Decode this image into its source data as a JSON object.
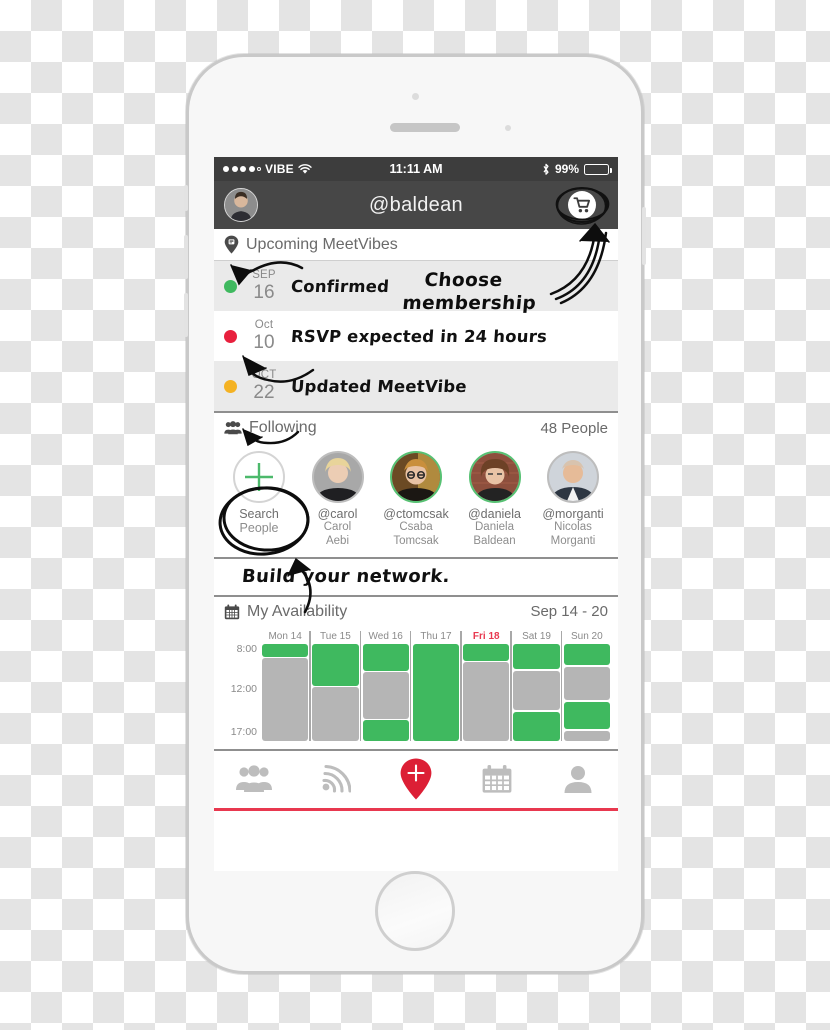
{
  "device": {
    "name": "iphone-white",
    "frame_color": "#f7f7f7",
    "accent_red": "#e8384f"
  },
  "status_bar": {
    "carrier": "VIBE",
    "signal_filled": 4,
    "signal_total": 5,
    "wifi_icon": "wifi-icon",
    "time": "11:11 AM",
    "bluetooth_icon": "bluetooth-icon",
    "battery_percent": "99%",
    "battery_level": 99
  },
  "nav_bar": {
    "avatar_icon": "user-avatar",
    "title": "@baldean",
    "cart_icon": "shopping-cart-icon"
  },
  "upcoming": {
    "header_icon": "map-pin-icon",
    "header_title": "Upcoming MeetVibes",
    "rows": [
      {
        "dot_color": "#3fb95f",
        "status": "confirmed",
        "month": "SEP",
        "day": "16",
        "note": "Confirmed"
      },
      {
        "dot_color": "#e8203d",
        "status": "rsvp-pending",
        "month": "Oct",
        "day": "10",
        "note": "RSVP expected in 24 hours"
      },
      {
        "dot_color": "#f4b223",
        "status": "updated",
        "month": "OCT",
        "day": "22",
        "note": "Updated MeetVibe"
      }
    ]
  },
  "following": {
    "header_icon": "people-group-icon",
    "header_title": "Following",
    "count_label": "48 People",
    "items": [
      {
        "type": "add",
        "icon": "plus-icon",
        "handle": "Search",
        "name": "People",
        "online": false,
        "ring": "#d4d4d4"
      },
      {
        "type": "person",
        "handle": "@carol",
        "name_line1": "Carol",
        "name_line2": "Aebi",
        "online": false,
        "ring": "#bdbdbd"
      },
      {
        "type": "person",
        "handle": "@ctomcsak",
        "name_line1": "Csaba",
        "name_line2": "Tomcsak",
        "online": true,
        "ring": "#57c173"
      },
      {
        "type": "person",
        "handle": "@daniela",
        "name_line1": "Daniela",
        "name_line2": "Baldean",
        "online": true,
        "ring": "#57c173"
      },
      {
        "type": "person",
        "handle": "@morganti",
        "name_line1": "Nicolas",
        "name_line2": "Morganti",
        "online": false,
        "ring": "#bdbdbd"
      }
    ]
  },
  "build_band": {
    "text": "Build your network."
  },
  "availability": {
    "header_icon": "calendar-icon",
    "header_title": "My Availability",
    "date_range": "Sep 14 - 20"
  },
  "chart_data": {
    "type": "bar",
    "title": "My Availability",
    "subtitle": "Sep 14 - 20",
    "xlabel": "",
    "ylabel": "",
    "grid": false,
    "legend_position": "none",
    "y_ticks": [
      "8:00",
      "12:00",
      "17:00"
    ],
    "y_tick_positions_pct": [
      4,
      46,
      96
    ],
    "ylim_labels": [
      "8:00",
      "17:00"
    ],
    "categories": [
      "Mon 14",
      "Tue 15",
      "Wed 16",
      "Thu 17",
      "Fri 18",
      "Sat 19",
      "Sun 20"
    ],
    "today": "Fri 18",
    "colors": {
      "free": "#3fb95f",
      "busy": "#b5b5b5"
    },
    "series": [
      {
        "name": "Mon 14",
        "segments": [
          {
            "state": "free",
            "top_pct": 0,
            "height_pct": 13
          },
          {
            "state": "busy",
            "top_pct": 14,
            "height_pct": 86
          }
        ]
      },
      {
        "name": "Tue 15",
        "segments": [
          {
            "state": "free",
            "top_pct": 0,
            "height_pct": 43
          },
          {
            "state": "busy",
            "top_pct": 44,
            "height_pct": 56
          }
        ]
      },
      {
        "name": "Wed 16",
        "segments": [
          {
            "state": "free",
            "top_pct": 0,
            "height_pct": 28
          },
          {
            "state": "busy",
            "top_pct": 29,
            "height_pct": 48
          },
          {
            "state": "free",
            "top_pct": 78,
            "height_pct": 22
          }
        ]
      },
      {
        "name": "Thu 17",
        "segments": [
          {
            "state": "free",
            "top_pct": 0,
            "height_pct": 100
          }
        ]
      },
      {
        "name": "Fri 18",
        "segments": [
          {
            "state": "free",
            "top_pct": 0,
            "height_pct": 18
          },
          {
            "state": "busy",
            "top_pct": 19,
            "height_pct": 81
          }
        ]
      },
      {
        "name": "Sat 19",
        "segments": [
          {
            "state": "free",
            "top_pct": 0,
            "height_pct": 26
          },
          {
            "state": "busy",
            "top_pct": 28,
            "height_pct": 40
          },
          {
            "state": "free",
            "top_pct": 70,
            "height_pct": 30
          }
        ]
      },
      {
        "name": "Sun 20",
        "segments": [
          {
            "state": "free",
            "top_pct": 0,
            "height_pct": 22
          },
          {
            "state": "busy",
            "top_pct": 24,
            "height_pct": 34
          },
          {
            "state": "free",
            "top_pct": 60,
            "height_pct": 28
          },
          {
            "state": "busy",
            "top_pct": 90,
            "height_pct": 10
          }
        ]
      }
    ]
  },
  "tab_bar": {
    "items": [
      {
        "icon": "people-group-icon",
        "active": false
      },
      {
        "icon": "broadcast-signal-icon",
        "active": false
      },
      {
        "icon": "add-location-pin-icon",
        "active": true
      },
      {
        "icon": "calendar-icon",
        "active": false
      },
      {
        "icon": "person-profile-icon",
        "active": false
      }
    ]
  },
  "annotations": [
    {
      "id": "choose-membership",
      "text_line1": "Choose",
      "text_line2": "membership"
    }
  ]
}
